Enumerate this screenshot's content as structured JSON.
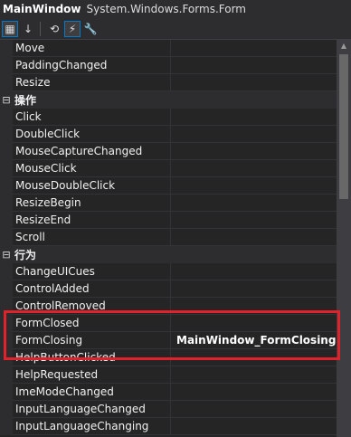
{
  "title": {
    "object_name": "MainWindow",
    "object_type": "System.Windows.Forms.Form"
  },
  "toolbar": {
    "buttons": [
      {
        "icon": "categorized-icon",
        "glyph": "▦",
        "active": true
      },
      {
        "icon": "alphabetical-icon",
        "glyph": "↓",
        "active": false
      },
      {
        "icon": "properties-icon",
        "glyph": "⟲",
        "active": false
      },
      {
        "icon": "events-icon",
        "glyph": "⚡",
        "active": true
      },
      {
        "icon": "property-pages-icon",
        "glyph": "🔧",
        "active": false
      }
    ]
  },
  "rows": [
    {
      "kind": "prop",
      "name": "Move",
      "value": ""
    },
    {
      "kind": "prop",
      "name": "PaddingChanged",
      "value": ""
    },
    {
      "kind": "prop",
      "name": "Resize",
      "value": ""
    },
    {
      "kind": "cat",
      "toggle": "⊟",
      "name": "操作"
    },
    {
      "kind": "prop",
      "name": "Click",
      "value": ""
    },
    {
      "kind": "prop",
      "name": "DoubleClick",
      "value": ""
    },
    {
      "kind": "prop",
      "name": "MouseCaptureChanged",
      "value": ""
    },
    {
      "kind": "prop",
      "name": "MouseClick",
      "value": ""
    },
    {
      "kind": "prop",
      "name": "MouseDoubleClick",
      "value": ""
    },
    {
      "kind": "prop",
      "name": "ResizeBegin",
      "value": ""
    },
    {
      "kind": "prop",
      "name": "ResizeEnd",
      "value": ""
    },
    {
      "kind": "prop",
      "name": "Scroll",
      "value": ""
    },
    {
      "kind": "cat",
      "toggle": "⊟",
      "name": "行为"
    },
    {
      "kind": "prop",
      "name": "ChangeUICues",
      "value": ""
    },
    {
      "kind": "prop",
      "name": "ControlAdded",
      "value": ""
    },
    {
      "kind": "prop",
      "name": "ControlRemoved",
      "value": ""
    },
    {
      "kind": "prop",
      "name": "FormClosed",
      "value": ""
    },
    {
      "kind": "prop",
      "name": "FormClosing",
      "value": "MainWindow_FormClosing"
    },
    {
      "kind": "prop",
      "name": "HelpButtonClicked",
      "value": ""
    },
    {
      "kind": "prop",
      "name": "HelpRequested",
      "value": ""
    },
    {
      "kind": "prop",
      "name": "ImeModeChanged",
      "value": ""
    },
    {
      "kind": "prop",
      "name": "InputLanguageChanged",
      "value": ""
    },
    {
      "kind": "prop",
      "name": "InputLanguageChanging",
      "value": ""
    }
  ],
  "colors": {
    "highlight": "#e0232a",
    "background": "#252526",
    "accent": "#007acc"
  }
}
